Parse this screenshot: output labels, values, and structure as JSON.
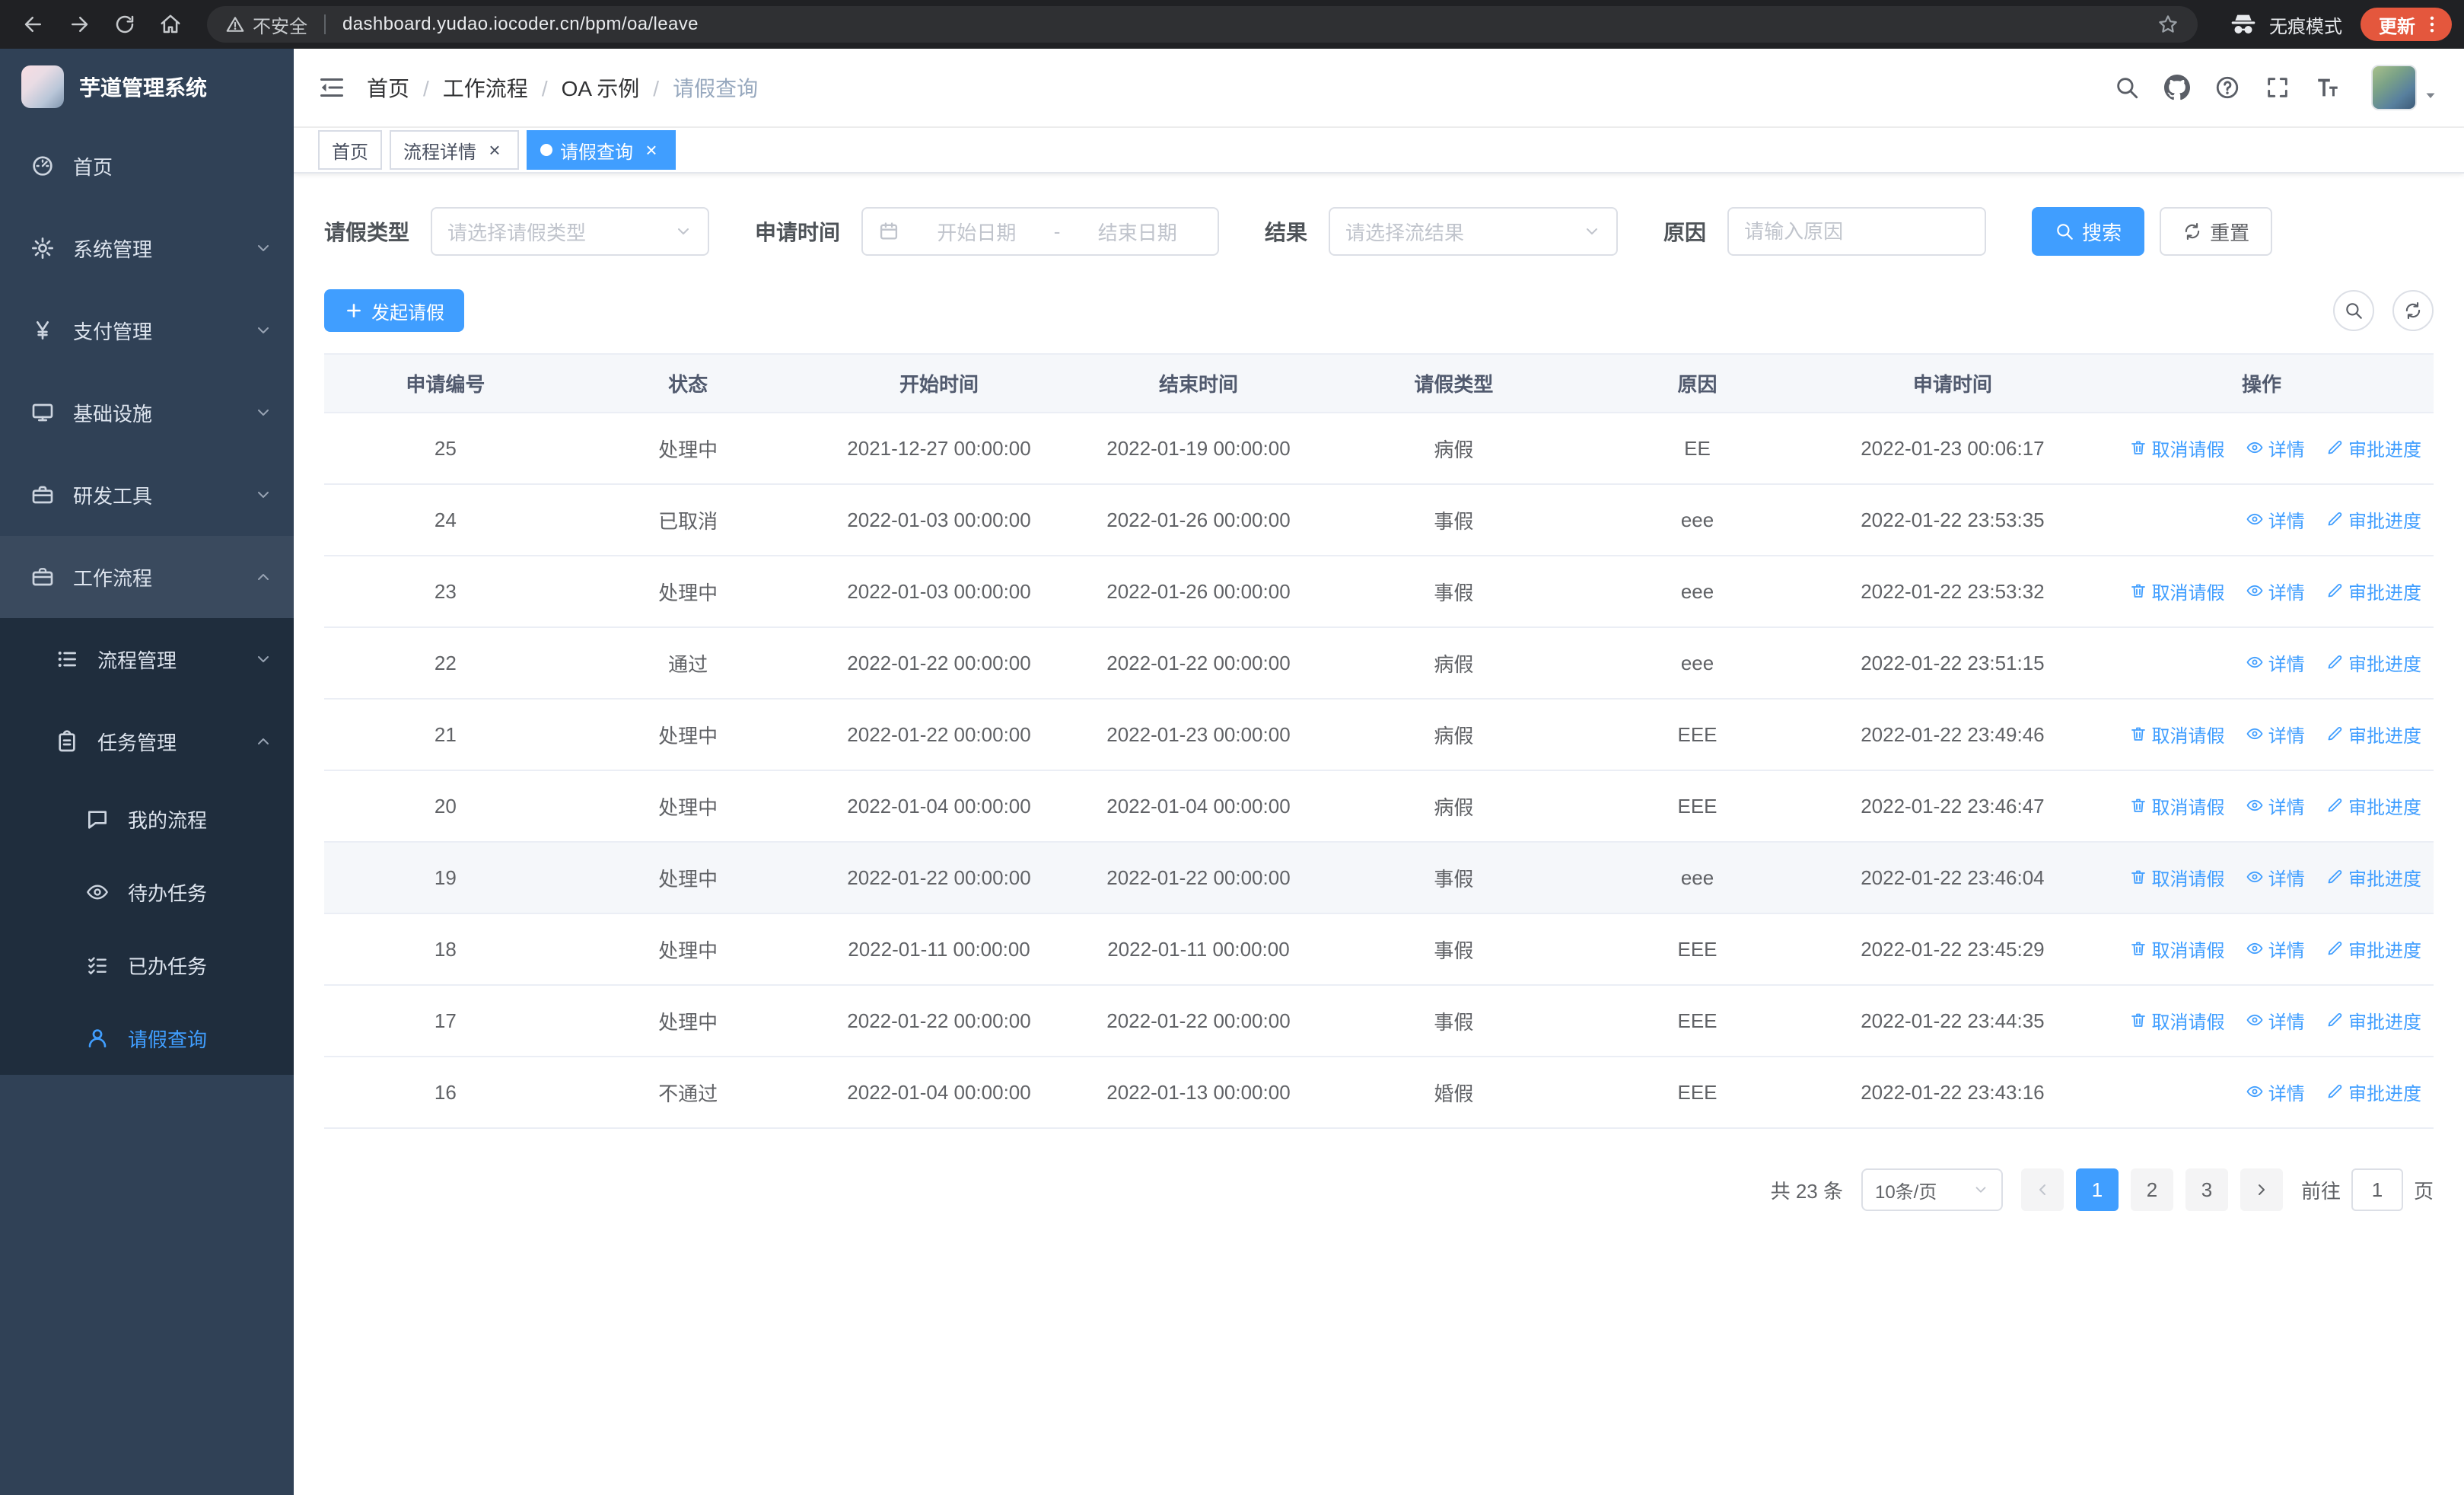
{
  "colors": {
    "accent": "#409eff",
    "sidebar_bg": "#304156",
    "sidebar_sub_bg": "#1f2d3d",
    "update_chip": "#e4573d"
  },
  "browser": {
    "security_label": "不安全",
    "url": "dashboard.yudao.iocoder.cn/bpm/oa/leave",
    "incognito_label": "无痕模式",
    "update_label": "更新"
  },
  "sidebar": {
    "logo_title": "芋道管理系统",
    "home": "首页",
    "system_mgmt": "系统管理",
    "payment_mgmt": "支付管理",
    "infrastructure": "基础设施",
    "dev_tools": "研发工具",
    "workflow": "工作流程",
    "process_mgmt": "流程管理",
    "task_mgmt": "任务管理",
    "my_process": "我的流程",
    "todo_tasks": "待办任务",
    "done_tasks": "已办任务",
    "leave_query": "请假查询"
  },
  "navbar": {
    "breadcrumb": [
      "首页",
      "工作流程",
      "OA 示例",
      "请假查询"
    ]
  },
  "tabs": [
    {
      "label": "首页",
      "closable": false,
      "active": false
    },
    {
      "label": "流程详情",
      "closable": true,
      "active": false
    },
    {
      "label": "请假查询",
      "closable": true,
      "active": true
    }
  ],
  "filters": {
    "leave_type_label": "请假类型",
    "leave_type_placeholder": "请选择请假类型",
    "apply_time_label": "申请时间",
    "start_date_placeholder": "开始日期",
    "date_separator": "-",
    "end_date_placeholder": "结束日期",
    "result_label": "结果",
    "result_placeholder": "请选择流结果",
    "reason_label": "原因",
    "reason_placeholder": "请输入原因",
    "search_button": "搜索",
    "reset_button": "重置"
  },
  "toolbar": {
    "create_button": "发起请假"
  },
  "table": {
    "columns": [
      "申请编号",
      "状态",
      "开始时间",
      "结束时间",
      "请假类型",
      "原因",
      "申请时间",
      "操作"
    ],
    "actions": {
      "cancel": "取消请假",
      "detail": "详情",
      "progress": "审批进度"
    },
    "rows": [
      {
        "id": "25",
        "status": "处理中",
        "start_time": "2021-12-27 00:00:00",
        "end_time": "2022-01-19 00:00:00",
        "leave_type": "病假",
        "reason": "EE",
        "apply_time": "2022-01-23 00:06:17",
        "can_cancel": true,
        "highlight": false
      },
      {
        "id": "24",
        "status": "已取消",
        "start_time": "2022-01-03 00:00:00",
        "end_time": "2022-01-26 00:00:00",
        "leave_type": "事假",
        "reason": "eee",
        "apply_time": "2022-01-22 23:53:35",
        "can_cancel": false,
        "highlight": false
      },
      {
        "id": "23",
        "status": "处理中",
        "start_time": "2022-01-03 00:00:00",
        "end_time": "2022-01-26 00:00:00",
        "leave_type": "事假",
        "reason": "eee",
        "apply_time": "2022-01-22 23:53:32",
        "can_cancel": true,
        "highlight": false
      },
      {
        "id": "22",
        "status": "通过",
        "start_time": "2022-01-22 00:00:00",
        "end_time": "2022-01-22 00:00:00",
        "leave_type": "病假",
        "reason": "eee",
        "apply_time": "2022-01-22 23:51:15",
        "can_cancel": false,
        "highlight": false
      },
      {
        "id": "21",
        "status": "处理中",
        "start_time": "2022-01-22 00:00:00",
        "end_time": "2022-01-23 00:00:00",
        "leave_type": "病假",
        "reason": "EEE",
        "apply_time": "2022-01-22 23:49:46",
        "can_cancel": true,
        "highlight": false
      },
      {
        "id": "20",
        "status": "处理中",
        "start_time": "2022-01-04 00:00:00",
        "end_time": "2022-01-04 00:00:00",
        "leave_type": "病假",
        "reason": "EEE",
        "apply_time": "2022-01-22 23:46:47",
        "can_cancel": true,
        "highlight": false
      },
      {
        "id": "19",
        "status": "处理中",
        "start_time": "2022-01-22 00:00:00",
        "end_time": "2022-01-22 00:00:00",
        "leave_type": "事假",
        "reason": "eee",
        "apply_time": "2022-01-22 23:46:04",
        "can_cancel": true,
        "highlight": true
      },
      {
        "id": "18",
        "status": "处理中",
        "start_time": "2022-01-11 00:00:00",
        "end_time": "2022-01-11 00:00:00",
        "leave_type": "事假",
        "reason": "EEE",
        "apply_time": "2022-01-22 23:45:29",
        "can_cancel": true,
        "highlight": false
      },
      {
        "id": "17",
        "status": "处理中",
        "start_time": "2022-01-22 00:00:00",
        "end_time": "2022-01-22 00:00:00",
        "leave_type": "事假",
        "reason": "EEE",
        "apply_time": "2022-01-22 23:44:35",
        "can_cancel": true,
        "highlight": false
      },
      {
        "id": "16",
        "status": "不通过",
        "start_time": "2022-01-04 00:00:00",
        "end_time": "2022-01-13 00:00:00",
        "leave_type": "婚假",
        "reason": "EEE",
        "apply_time": "2022-01-22 23:43:16",
        "can_cancel": false,
        "highlight": false
      }
    ]
  },
  "pagination": {
    "total": "共 23 条",
    "page_size": "10条/页",
    "pages": [
      {
        "label": "1",
        "active": true
      },
      {
        "label": "2",
        "active": false
      },
      {
        "label": "3",
        "active": false
      }
    ],
    "goto_label": "前往",
    "goto_value": "1",
    "goto_unit": "页"
  }
}
